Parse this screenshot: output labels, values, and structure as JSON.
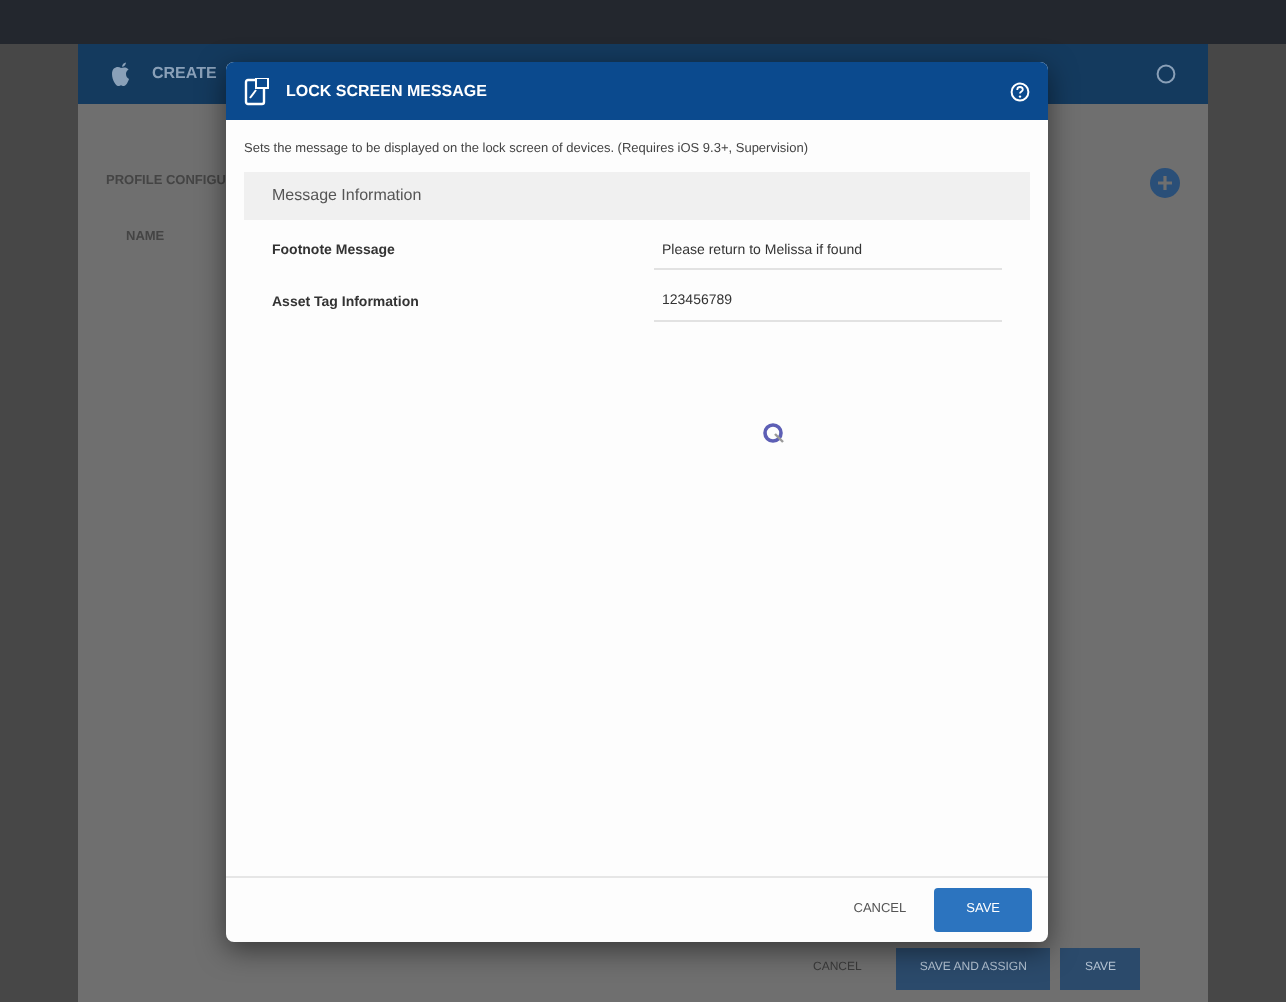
{
  "background_page": {
    "title": "CREATE",
    "section_title": "PROFILE CONFIGU",
    "column_1": "NAME",
    "footer_buttons": [
      {
        "label": "CANCEL",
        "kind": "link"
      },
      {
        "label": "SAVE AND ASSIGN",
        "kind": "primary"
      },
      {
        "label": "SAVE",
        "kind": "primary"
      }
    ]
  },
  "dialog": {
    "title": "LOCK SCREEN MESSAGE",
    "description": "Sets the message to be displayed on the lock screen of devices. (Requires iOS 9.3+, Supervision)",
    "section": "Message Information",
    "fields": [
      {
        "label": "Footnote Message",
        "value": "Please return to Melissa if found"
      },
      {
        "label": "Asset Tag Information",
        "value": "123456789"
      }
    ],
    "buttons": [
      {
        "label": "CANCEL",
        "kind": "link"
      },
      {
        "label": "SAVE",
        "kind": "primary"
      }
    ]
  }
}
